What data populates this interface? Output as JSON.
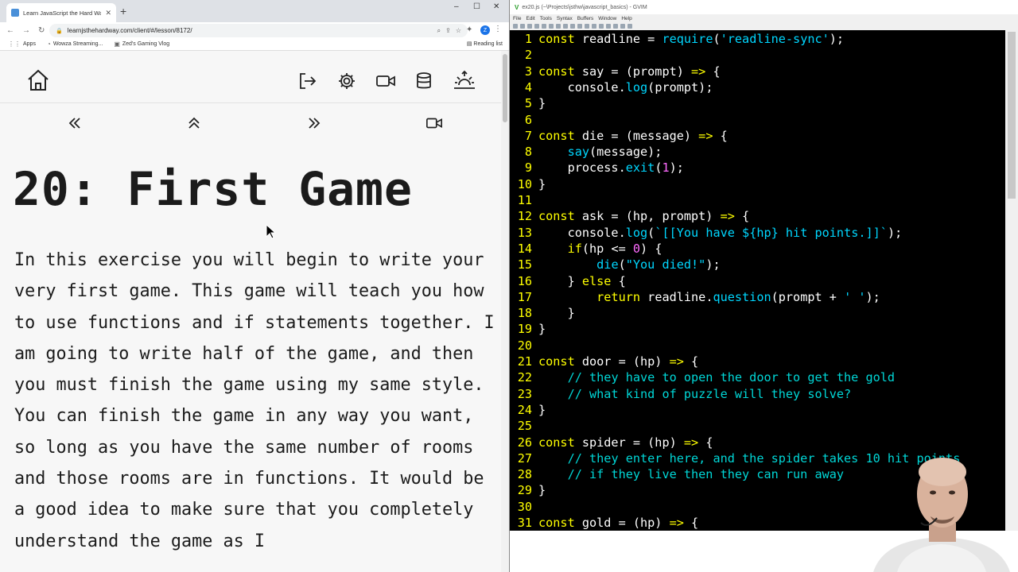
{
  "browser": {
    "tab_title": "Learn JavaScript the Hard Way",
    "url": "learnjsthehardway.com/client/#/lesson/8172/",
    "bookmarks": [
      "Apps",
      "Wowza Streaming...",
      "Zed's Gaming Vlog"
    ],
    "reading_list": "Reading list",
    "profile_initial": "Z"
  },
  "lesson": {
    "title": "20: First Game",
    "body": "In this exercise you will begin to write your very first game. This game will teach you how to use functions and if statements together. I am going to write half of the game, and then you must finish the game using my same style. You can finish the game in any way you want, so long as you have the same number of rooms and those rooms are in functions. It would be a good idea to make sure that you completely understand the game as I"
  },
  "gvim": {
    "title": "ex20.js (~\\Projects\\jsthw\\javascript_basics) - GVIM",
    "menu": [
      "File",
      "Edit",
      "Tools",
      "Syntax",
      "Buffers",
      "Window",
      "Help"
    ]
  },
  "code": {
    "line_numbers": [
      "1",
      "2",
      "3",
      "4",
      "5",
      "6",
      "7",
      "8",
      "9",
      "10",
      "11",
      "12",
      "13",
      "14",
      "15",
      "16",
      "17",
      "18",
      "19",
      "20",
      "21",
      "22",
      "23",
      "24",
      "25",
      "26",
      "27",
      "28",
      "29",
      "30",
      "31"
    ],
    "lines": [
      "const readline = require('readline-sync');",
      "",
      "const say = (prompt) => {",
      "    console.log(prompt);",
      "}",
      "",
      "const die = (message) => {",
      "    say(message);",
      "    process.exit(1);",
      "}",
      "",
      "const ask = (hp, prompt) => {",
      "    console.log(`[[You have ${hp} hit points.]]`);",
      "    if(hp <= 0) {",
      "        die(\"You died!\");",
      "    } else {",
      "        return readline.question(prompt + ' ');",
      "    }",
      "}",
      "",
      "const door = (hp) => {",
      "    // they have to open the door to get the gold",
      "    // what kind of puzzle will they solve?",
      "}",
      "",
      "const spider = (hp) => {",
      "    // they enter here, and the spider takes 10 hit points",
      "    // if they live then they can run away",
      "}",
      "",
      "const gold = (hp) => {"
    ]
  },
  "colors": {
    "line_number": "#ffff00",
    "keyword": "#ffff00",
    "string": "#00d7ff",
    "comment": "#00d7d7",
    "number": "#ff6bff",
    "editor_bg": "#000000"
  }
}
